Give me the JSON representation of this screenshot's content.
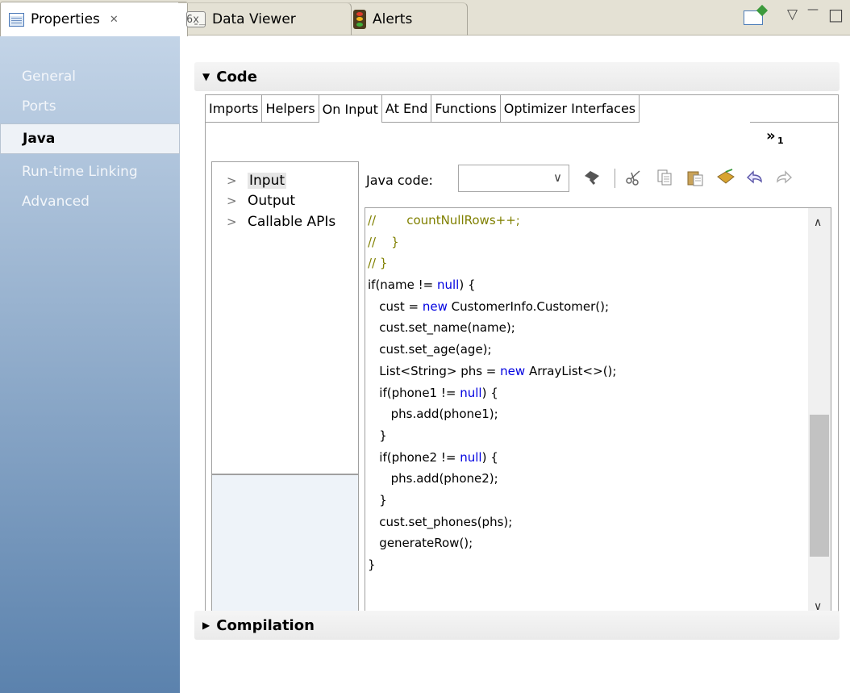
{
  "view_tabs": [
    {
      "label": "Properties",
      "close": "✕"
    },
    {
      "label": "Data Viewer"
    },
    {
      "label": "Alerts"
    }
  ],
  "view_controls": {
    "data_viewer_icon_glyph": "6̱x̲",
    "menu": "▽",
    "minimize": "—",
    "maximize": "□"
  },
  "nav": {
    "items": [
      "General",
      "Ports",
      "Java",
      "Run-time Linking",
      "Advanced"
    ],
    "selected": "Java"
  },
  "code_section": {
    "title": "Code",
    "toggle": "▼",
    "tabs": [
      "Imports",
      "Helpers",
      "On Input",
      "At End",
      "Functions",
      "Optimizer Interfaces"
    ],
    "active_tab": "On Input",
    "overflow_chevron": "»",
    "overflow_count": "1"
  },
  "tree": {
    "items": [
      {
        "label": "Input",
        "arrow": ">"
      },
      {
        "label": "Output",
        "arrow": ">"
      },
      {
        "label": "Callable APIs",
        "arrow": ">"
      }
    ],
    "selected": "Input"
  },
  "java_code": {
    "label": "Java code:",
    "select_value": "",
    "caret": "∨",
    "icons": [
      "find-icon",
      "cut-icon",
      "copy-icon",
      "paste-icon",
      "insert-icon",
      "undo-icon",
      "redo-icon"
    ]
  },
  "code_lines": [
    [
      {
        "t": "//        countNullRows++;",
        "c": "cm"
      }
    ],
    [
      {
        "t": "//    }",
        "c": "cm"
      }
    ],
    [
      {
        "t": "// }",
        "c": "cm"
      }
    ],
    [
      {
        "t": "if(name != "
      },
      {
        "t": "null",
        "c": "kw"
      },
      {
        "t": ") {"
      }
    ],
    [
      {
        "t": "   cust = "
      },
      {
        "t": "new",
        "c": "kw"
      },
      {
        "t": " CustomerInfo.Customer();"
      }
    ],
    [
      {
        "t": "   cust.set_name(name);"
      }
    ],
    [
      {
        "t": "   cust.set_age(age);"
      }
    ],
    [
      {
        "t": "   List<String> phs = "
      },
      {
        "t": "new",
        "c": "kw"
      },
      {
        "t": " ArrayList<>();"
      }
    ],
    [
      {
        "t": "   if(phone1 != "
      },
      {
        "t": "null",
        "c": "kw"
      },
      {
        "t": ") {"
      }
    ],
    [
      {
        "t": "      phs.add(phone1);"
      }
    ],
    [
      {
        "t": "   }"
      }
    ],
    [
      {
        "t": "   if(phone2 != "
      },
      {
        "t": "null",
        "c": "kw"
      },
      {
        "t": ") {"
      }
    ],
    [
      {
        "t": "      phs.add(phone2);"
      }
    ],
    [
      {
        "t": "   }"
      }
    ],
    [
      {
        "t": "   cust.set_phones(phs);"
      }
    ],
    [
      {
        "t": "   generateRow();"
      }
    ],
    [
      {
        "t": "}"
      }
    ]
  ],
  "scrollbar": {
    "up": "∧",
    "down": "∨"
  },
  "compilation_section": {
    "title": "Compilation",
    "toggle": "▶"
  }
}
